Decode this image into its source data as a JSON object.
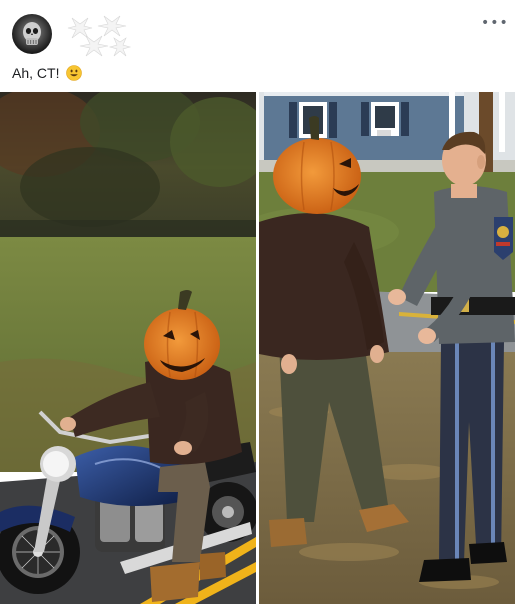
{
  "post": {
    "author_avatar": "skull-avatar",
    "author_name": "",
    "more_icon": "more-options-icon",
    "more_glyph": "•••",
    "text": "Ah, CT!",
    "emoji": "smile-emoji"
  },
  "photos": [
    {
      "name": "photo-pumpkin-rider",
      "description_icon": "photo"
    },
    {
      "name": "photo-pumpkin-officer",
      "description_icon": "photo"
    }
  ],
  "colors": {
    "pumpkin": "#e77a1f",
    "road": "#3e3f41",
    "road_line": "#f0b31a",
    "grass": "#6f7d3a",
    "uniform": "#5e6468",
    "trousers": "#2c3346",
    "jacket": "#3a2720"
  }
}
